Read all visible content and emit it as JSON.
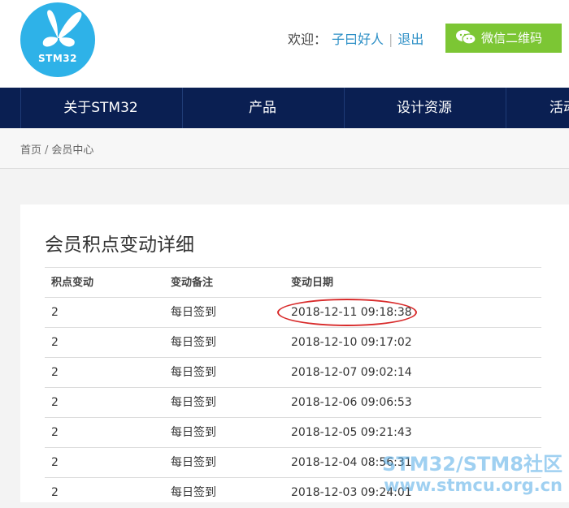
{
  "header": {
    "logo_text": "STM32",
    "welcome": "欢迎：",
    "username": "子曰好人",
    "separator": "|",
    "logout": "退出",
    "wechat_label": "微信二维码",
    "colors": {
      "logo_bg": "#2eb2e8",
      "wechat_bg": "#7cc634",
      "link": "#2c8fc6"
    }
  },
  "nav": {
    "items": [
      {
        "label": "关于STM32"
      },
      {
        "label": "产品"
      },
      {
        "label": "设计资源"
      },
      {
        "label": "活动"
      }
    ],
    "color": "#0a1f52"
  },
  "breadcrumb": {
    "home": "首页",
    "separator": "/",
    "current": "会员中心"
  },
  "panel": {
    "title": "会员积点变动详细",
    "columns": [
      "积点变动",
      "变动备注",
      "变动日期"
    ],
    "rows": [
      {
        "points": "2",
        "note": "每日签到",
        "date": "2018-12-11 09:18:38"
      },
      {
        "points": "2",
        "note": "每日签到",
        "date": "2018-12-10 09:17:02"
      },
      {
        "points": "2",
        "note": "每日签到",
        "date": "2018-12-07 09:02:14"
      },
      {
        "points": "2",
        "note": "每日签到",
        "date": "2018-12-06 09:06:53"
      },
      {
        "points": "2",
        "note": "每日签到",
        "date": "2018-12-05 09:21:43"
      },
      {
        "points": "2",
        "note": "每日签到",
        "date": "2018-12-04 08:56:31"
      },
      {
        "points": "2",
        "note": "每日签到",
        "date": "2018-12-03 09:24:01"
      }
    ]
  },
  "watermark": {
    "line1": "STM32/STM8社区",
    "line2": "www.stmcu.org.cn"
  },
  "annotation_color": "#d82b2b"
}
